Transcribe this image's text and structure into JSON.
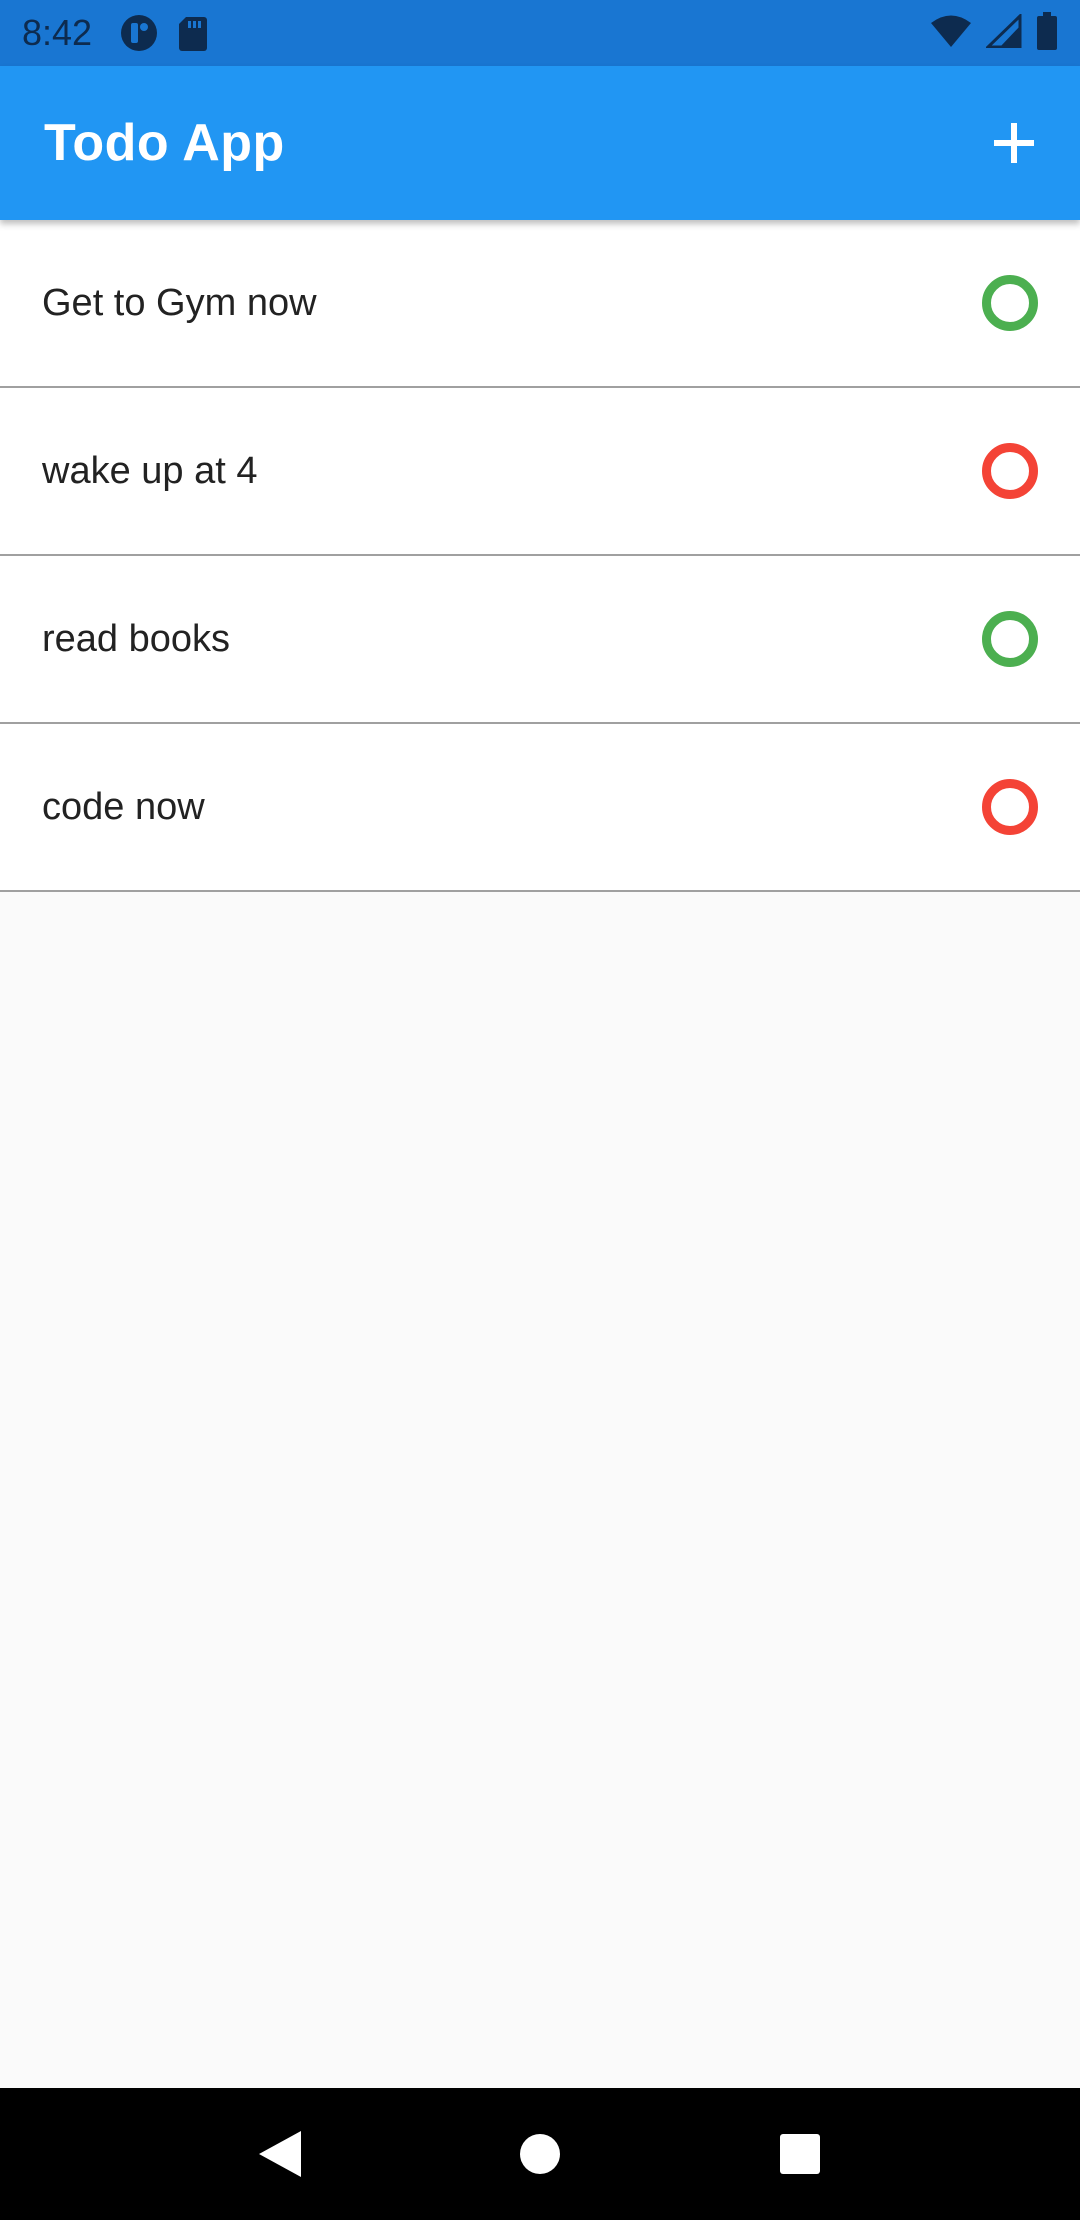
{
  "status_bar": {
    "time": "8:42"
  },
  "app_bar": {
    "title": "Todo App",
    "add_icon": "plus-icon"
  },
  "todos": [
    {
      "label": "Get to Gym now",
      "status_color": "#4caf50"
    },
    {
      "label": "wake up at 4",
      "status_color": "#f44336"
    },
    {
      "label": "read books",
      "status_color": "#4caf50"
    },
    {
      "label": "code now",
      "status_color": "#f44336"
    }
  ],
  "colors": {
    "status_bar": "#1976d2",
    "app_bar": "#2196f3",
    "done": "#4caf50",
    "pending": "#f44336"
  },
  "nav_bar": {
    "icons": [
      "back-icon",
      "home-icon",
      "recents-icon"
    ]
  }
}
